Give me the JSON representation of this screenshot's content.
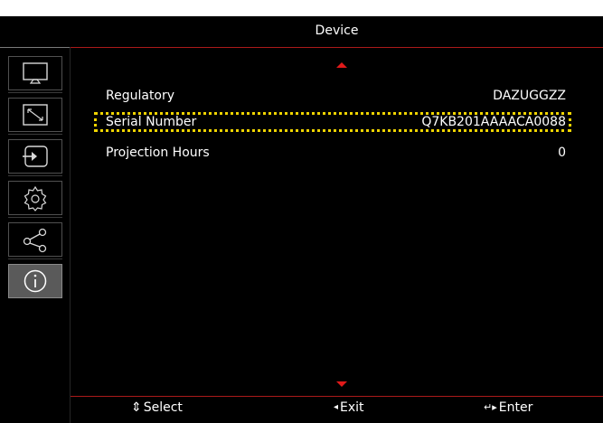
{
  "header": {
    "title": "Device"
  },
  "sidebar": {
    "items": [
      {
        "icon": "display-icon",
        "active": false
      },
      {
        "icon": "resize-icon",
        "active": false
      },
      {
        "icon": "input-icon",
        "active": false
      },
      {
        "icon": "settings-icon",
        "active": false
      },
      {
        "icon": "network-icon",
        "active": false
      },
      {
        "icon": "info-icon",
        "active": true
      }
    ]
  },
  "rows": [
    {
      "label": "Regulatory",
      "value": "DAZUGGZZ",
      "selected": false
    },
    {
      "label": "Serial Number",
      "value": "Q7KB201AAAACA0088",
      "selected": true
    },
    {
      "label": "Projection Hours",
      "value": "0",
      "selected": false
    }
  ],
  "footer": {
    "select_glyph": "⇕",
    "select_label": "Select",
    "exit_glyph": "◂",
    "exit_label": "Exit",
    "enter_glyph": "↵▸",
    "enter_label": "Enter"
  },
  "colors": {
    "background": "#000000",
    "accent_red": "#e01a1a",
    "selection_yellow": "#f0d400",
    "active_item": "#5a5a5a"
  }
}
